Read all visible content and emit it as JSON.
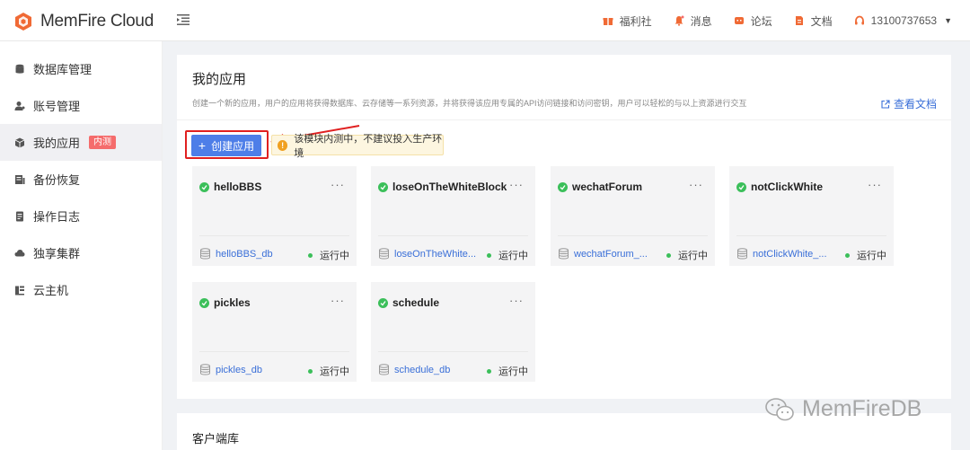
{
  "app": {
    "logo_text": "MemFire Cloud"
  },
  "top_nav": {
    "items": [
      {
        "label": "福利社",
        "icon": "gift-icon"
      },
      {
        "label": "消息",
        "icon": "bell-icon"
      },
      {
        "label": "论坛",
        "icon": "forum-icon"
      },
      {
        "label": "文档",
        "icon": "document-icon"
      }
    ],
    "user": "13100737653"
  },
  "sidebar": {
    "items": [
      {
        "label": "数据库管理",
        "icon": "database-icon"
      },
      {
        "label": "账号管理",
        "icon": "user-icon"
      },
      {
        "label": "我的应用",
        "icon": "cube-icon",
        "badge": "内测",
        "active": true
      },
      {
        "label": "备份恢复",
        "icon": "backup-icon"
      },
      {
        "label": "操作日志",
        "icon": "log-icon"
      },
      {
        "label": "独享集群",
        "icon": "cluster-icon"
      },
      {
        "label": "云主机",
        "icon": "server-icon"
      }
    ]
  },
  "main": {
    "title": "我的应用",
    "description": "创建一个新的应用，用户的应用将获得数据库、云存储等一系列资源，并将获得该应用专属的API访问链接和访问密钥，用户可以轻松的与以上资源进行交互",
    "doc_link": "查看文档",
    "create_button": "创建应用",
    "warning": "该模块内测中，不建议投入生产环境",
    "apps": [
      {
        "name": "helloBBS",
        "db": "helloBBS_db",
        "status": "运行中",
        "more": "···"
      },
      {
        "name": "loseOnTheWhiteBlock",
        "db": "loseOnTheWhite...",
        "status": "运行中",
        "more": "···"
      },
      {
        "name": "wechatForum",
        "db": "wechatForum_...",
        "status": "运行中",
        "more": "···"
      },
      {
        "name": "notClickWhite",
        "db": "notClickWhite_...",
        "status": "运行中",
        "more": "···"
      },
      {
        "name": "pickles",
        "db": "pickles_db",
        "status": "运行中",
        "more": "···"
      },
      {
        "name": "schedule",
        "db": "schedule_db",
        "status": "运行中",
        "more": "···"
      }
    ]
  },
  "section2": {
    "title": "客户端库"
  },
  "watermark": "MemFireDB",
  "colors": {
    "primary": "#4d7ee8",
    "success": "#3bbf5a",
    "danger": "#e02020",
    "brand_orange": "#f06a35"
  }
}
